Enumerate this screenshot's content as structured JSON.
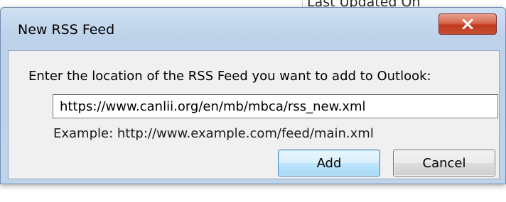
{
  "background": {
    "header_text": "Last Updated On"
  },
  "dialog": {
    "title": "New RSS Feed",
    "close_label": "Close",
    "prompt": "Enter the location of the RSS Feed you want to add to Outlook:",
    "url_value": "https://www.canlii.org/en/mb/mbca/rss_new.xml",
    "example": "Example: http://www.example.com/feed/main.xml",
    "add_label": "Add",
    "cancel_label": "Cancel"
  },
  "icons": {
    "close": "close-icon"
  },
  "colors": {
    "close_button": "#c44f33",
    "default_button_border": "#3c7fb1",
    "frame": "#bed3ea"
  }
}
